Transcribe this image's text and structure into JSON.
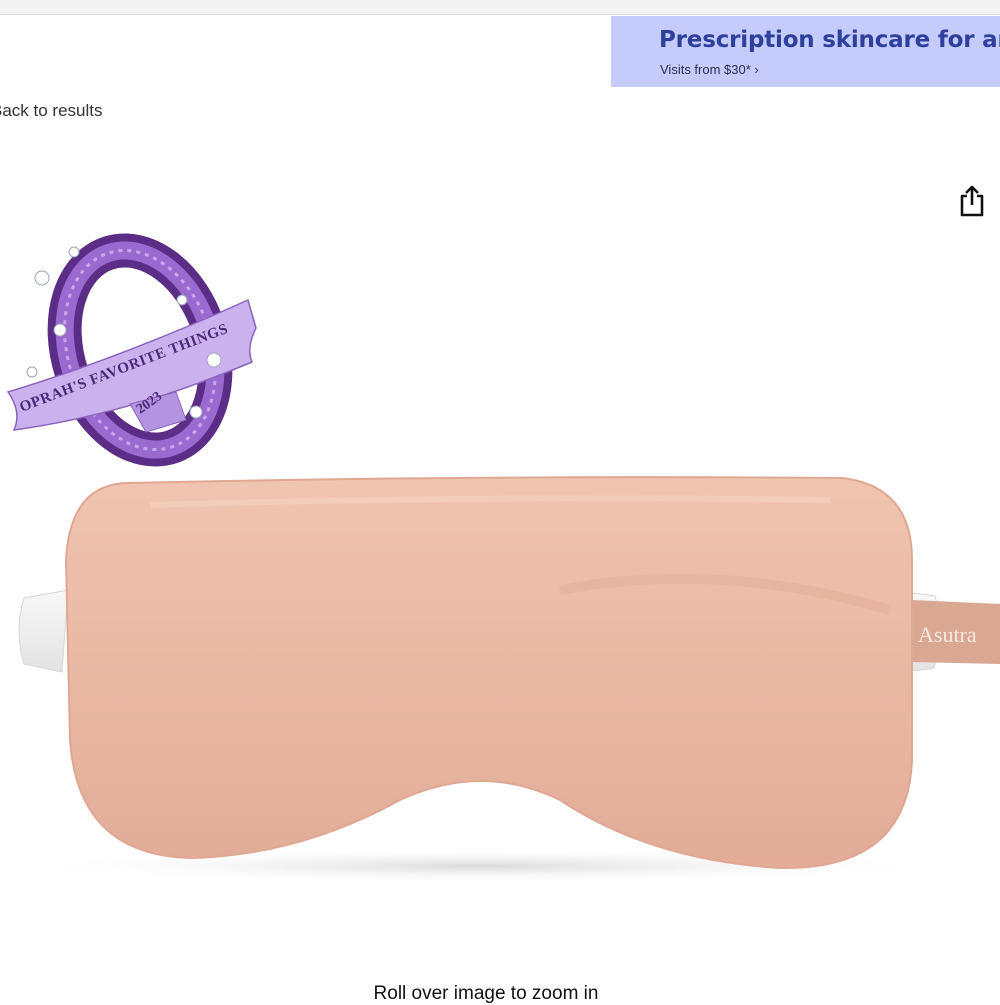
{
  "ad": {
    "headline": "Prescription skincare for anti-aging",
    "subtext": "Visits from $30* ›",
    "colors": {
      "background": "#c5cbfb",
      "headline": "#2f3f9e"
    }
  },
  "nav": {
    "back_label": "Back to results"
  },
  "toolbar": {
    "share_icon": "share-icon"
  },
  "product": {
    "badge": {
      "ribbon_text": "OPRAH'S FAVORITE THINGS",
      "year": "2023"
    },
    "brand_tag": "Asutra",
    "colors": {
      "mask": "#e9b9a4",
      "strap": "#efefef",
      "badge": "#7a4aa6"
    }
  },
  "zoom_hint": "Roll over image to zoom in"
}
